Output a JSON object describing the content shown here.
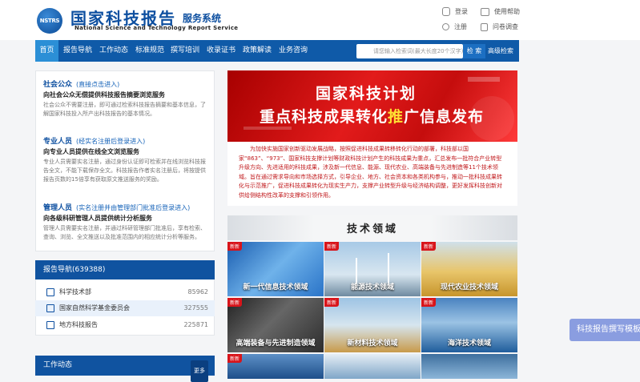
{
  "header": {
    "logo_text": "NSTRS",
    "title": "国家科技报告",
    "title_suffix": "服务系统",
    "subtitle_en": "National Science and Technology Report Service",
    "links": [
      "登录",
      "使用帮助",
      "注册",
      "问卷调查"
    ]
  },
  "nav": {
    "items": [
      "首页",
      "报告导航",
      "工作动态",
      "标准规范",
      "撰写培训",
      "收录证书",
      "政策解读",
      "业务咨询"
    ],
    "active_index": 0,
    "search_placeholder": "请您输入检索词(最大长度20个汉字)",
    "search_button": "检 索",
    "advanced_search": "高级检索"
  },
  "user_groups": [
    {
      "title": "社会公众",
      "hint": "(直接点击进入)",
      "heading": "向社会公众无偿提供科技报告摘要浏览服务",
      "desc": "社会公众不需要注册，即可通过检索科技报告摘要和基本信息，了解国家科技投入所产出科技报告的基本情况。"
    },
    {
      "title": "专业人员",
      "hint": "(经实名注册后登录进入)",
      "heading": "向专业人员提供在线全文浏览服务",
      "desc": "专业人员需要实名注册，通过身份认证即可检索并在线浏览科技报告全文，不能下载保存全文。科技报告作者实名注册后，将按提供报告页数的15倍享有获取原文推送服务的奖励。"
    },
    {
      "title": "管理人员",
      "hint": "(实名注册并由管理部门批准后登录进入)",
      "heading": "向各级科研管理人员提供统计分析服务",
      "desc": "管理人员需要实名注册，并通过科研管理部门批准后，享有检索、查询、浏览、全文推送以及批准范围内的相应统计分析等服务。"
    }
  ],
  "report_nav": {
    "title": "报告导航(639388)",
    "items": [
      {
        "label": "科学技术部",
        "count": "85962"
      },
      {
        "label": "国家自然科学基金委员会",
        "count": "327555"
      },
      {
        "label": "地方科技报告",
        "count": "225871"
      }
    ],
    "selected_index": 1
  },
  "work_news": {
    "title": "工作动态",
    "more": "更多"
  },
  "banner": {
    "line1": "国家科技计划",
    "line2_pre": "重点科技成果转化",
    "line2_hl": "推",
    "line2_post": "广信息发布"
  },
  "announcement": "为加快实施国家创新驱动发展战略，按照促进科技成果转移转化行动的部署，科技部以国家“863”、“973”、国家科技支撑计划等财政科技计划产生的科技成果为重点，汇总发布一批符合产业转型升级方向、先进适用的科技成果，涉及新一代信息、能源、现代农业、高端装备与先进制造等11个技术领域。旨在通过需求导向和市场选择方式，引导企业、地方、社会资本和各类机构参与，推动一批科技成果转化与示范推广，促进科技成果转化为现实生产力，支撑产业转型升级与经济结构调整，更好发挥科技创新对供给侧结构性改革的支撑和引领作用。",
  "tech_fields": {
    "title": "技术领域",
    "tag": "新新",
    "tiles": [
      "新一代信息技术领域",
      "能源技术领域",
      "现代农业技术领域",
      "高端装备与先进制造领域",
      "新材料技术领域",
      "海洋技术领域",
      "",
      "",
      ""
    ]
  },
  "float_button": "科技报告撰写模板"
}
